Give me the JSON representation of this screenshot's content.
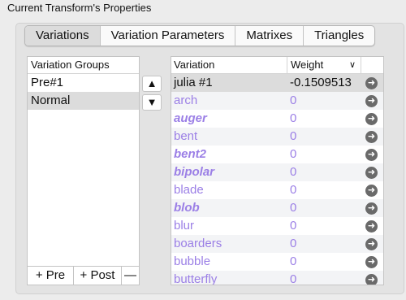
{
  "window": {
    "title": "Current Transform's Properties"
  },
  "tabs": [
    {
      "label": "Variations"
    },
    {
      "label": "Variation Parameters"
    },
    {
      "label": "Matrixes"
    },
    {
      "label": "Triangles"
    }
  ],
  "groups": {
    "header": "Variation Groups",
    "items": [
      "Pre#1",
      "Normal"
    ],
    "selected_index": 1,
    "footer": {
      "add_pre": "+ Pre",
      "add_post": "+ Post",
      "remove": "—"
    },
    "move_up": "▲",
    "move_down": "▼"
  },
  "variations": {
    "col_variation": "Variation",
    "col_weight": "Weight",
    "sort_icon": "chevron-down-icon",
    "rows": [
      {
        "name": "julia #1",
        "weight": "-0.1509513",
        "bold": false,
        "selected": true
      },
      {
        "name": "arch",
        "weight": "0",
        "bold": false
      },
      {
        "name": "auger",
        "weight": "0",
        "bold": true
      },
      {
        "name": "bent",
        "weight": "0",
        "bold": false
      },
      {
        "name": "bent2",
        "weight": "0",
        "bold": true
      },
      {
        "name": "bipolar",
        "weight": "0",
        "bold": true
      },
      {
        "name": "blade",
        "weight": "0",
        "bold": false
      },
      {
        "name": "blob",
        "weight": "0",
        "bold": true
      },
      {
        "name": "blur",
        "weight": "0",
        "bold": false
      },
      {
        "name": "boarders",
        "weight": "0",
        "bold": false
      },
      {
        "name": "bubble",
        "weight": "0",
        "bold": false
      },
      {
        "name": "butterfly",
        "weight": "0",
        "bold": false
      }
    ]
  },
  "colors": {
    "variation_text": "#9b7fe6",
    "selected_row": "#dcdcdc"
  }
}
